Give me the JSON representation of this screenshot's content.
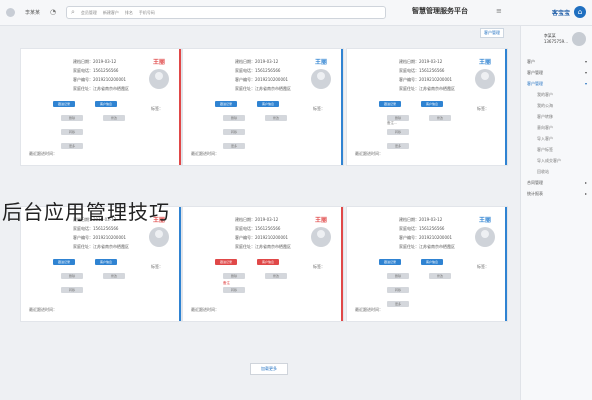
{
  "topbar": {
    "user": "李某某",
    "search_chips": [
      "会员管理",
      "新建客户",
      "排名",
      "手机号码"
    ],
    "title": "智慧管理服务平台",
    "menu_icon": "menu-icon",
    "logo_name": "客宝宝"
  },
  "tab_strip": "客户管理",
  "actions": {
    "primary": "新建",
    "secondary": "筛选"
  },
  "cards": [
    {
      "name": "王丽",
      "name_color": "#2f83d2",
      "stripe": "#2f83d2",
      "info": [
        "建档日期：2019-03-12",
        "家庭电话：1561256566",
        "客户编号：2019210200001",
        "家庭住址：江苏省南京市栖霞区"
      ],
      "tag_label": "标签：",
      "pills_row1": [
        "跟进记录",
        "客户信息"
      ],
      "pills_row2": [
        "删除",
        "修改"
      ],
      "pills_row3": [
        "转移"
      ],
      "pills_row4": [
        "更多"
      ],
      "note": "备注...",
      "foot": "最近跟进时间："
    },
    {
      "name": "王丽",
      "name_color": "#2f83d2",
      "stripe": "#2f83d2",
      "info": [
        "建档日期：2019-03-12",
        "家庭电话：1561256566",
        "客户编号：2019210200001",
        "家庭住址：江苏省南京市栖霞区"
      ],
      "tag_label": "标签：",
      "pills_row1": [
        "跟进记录",
        "客户信息"
      ],
      "pills_row2": [
        "删除",
        "修改"
      ],
      "pills_row3": [
        "转移"
      ],
      "pills_row4": [
        "更多"
      ],
      "note": "",
      "foot": "最近跟进时间："
    },
    {
      "name": "王丽",
      "name_color": "#e04848",
      "stripe": "#e04848",
      "info": [
        "建档日期：2019-03-12",
        "家庭电话：1561256566",
        "客户编号：2019210200001",
        "家庭住址：江苏省南京市栖霞区"
      ],
      "tag_label": "标签：",
      "pills_row1": [
        "跟进记录",
        "客户信息"
      ],
      "pills_row2": [
        "删除",
        "修改"
      ],
      "pills_row3": [
        "转移"
      ],
      "pills_row4": [
        "更多"
      ],
      "note": "",
      "foot": "最近跟进时间："
    },
    {
      "name": "王丽",
      "name_color": "#2f83d2",
      "stripe": "#2f83d2",
      "info": [
        "建档日期：2019-03-12",
        "家庭电话：1561256566",
        "客户编号：2019210200001",
        "家庭住址：江苏省南京市栖霞区"
      ],
      "tag_label": "标签：",
      "pills_row1": [
        "跟进记录",
        "客户信息"
      ],
      "pills_row2": [
        "删除",
        "修改"
      ],
      "pills_row3": [
        "转移"
      ],
      "pills_row4": [
        "更多"
      ],
      "note": "",
      "foot": "最近跟进时间："
    },
    {
      "name": "王丽",
      "name_color": "#e04848",
      "stripe": "#e04848",
      "info": [
        "建档日期：2019-03-12",
        "家庭电话：1561256566",
        "客户编号：2019210200001",
        "家庭住址：江苏省南京市栖霞区"
      ],
      "tag_label": "标签：",
      "pills_row1": [
        "跟进记录",
        "客户信息"
      ],
      "pills_row2": [
        "删除",
        "修改"
      ],
      "pills_row3": [
        "转移"
      ],
      "pills_row4": [],
      "note": "备注",
      "foot": "最近跟进时间：",
      "red_pills": true
    },
    {
      "name": "王丽",
      "name_color": "#e04848",
      "stripe": "#2f83d2",
      "info": [
        "建档日期：2019-03-12",
        "家庭电话：1561256566",
        "客户编号：2019210200001",
        "家庭住址：江苏省南京市栖霞区"
      ],
      "tag_label": "标签：",
      "pills_row1": [
        "跟进记录",
        "客户信息"
      ],
      "pills_row2": [
        "删除",
        "修改"
      ],
      "pills_row3": [
        "转移"
      ],
      "pills_row4": [],
      "note": "",
      "foot": "最近跟进时间："
    }
  ],
  "overlay_text": "后台应用管理技巧",
  "more_button": "加载更多",
  "sidebar": {
    "profile_name": "李某某",
    "profile_id": "13675759...",
    "items": [
      {
        "label": "客户",
        "sub": false,
        "arrow": "▾"
      },
      {
        "label": "客户管理",
        "sub": false,
        "arrow": "▾"
      },
      {
        "label": "客户管理",
        "sub": false,
        "arrow": "▾",
        "active": true
      },
      {
        "label": "我的客户",
        "sub": true,
        "arrow": ""
      },
      {
        "label": "我的公海",
        "sub": true,
        "arrow": ""
      },
      {
        "label": "客户转移",
        "sub": true,
        "arrow": ""
      },
      {
        "label": "意向客户",
        "sub": true,
        "arrow": ""
      },
      {
        "label": "导入客户",
        "sub": true,
        "arrow": ""
      },
      {
        "label": "客户标签",
        "sub": true,
        "arrow": ""
      },
      {
        "label": "导入成交客户",
        "sub": true,
        "arrow": ""
      },
      {
        "label": "回收站",
        "sub": true,
        "arrow": ""
      },
      {
        "label": "合同管理",
        "sub": false,
        "arrow": "▸"
      },
      {
        "label": "统计报表",
        "sub": false,
        "arrow": "▸"
      }
    ]
  }
}
